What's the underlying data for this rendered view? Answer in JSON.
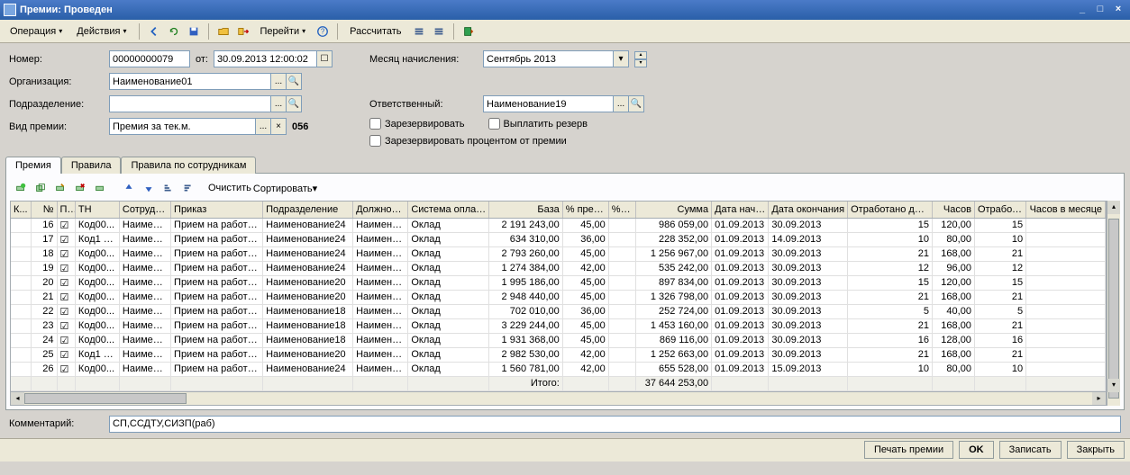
{
  "title": "Премии: Проведен",
  "toolbar": {
    "operation": "Операция",
    "actions": "Действия",
    "goto": "Перейти",
    "calculate": "Рассчитать"
  },
  "form": {
    "number_lbl": "Номер:",
    "number_val": "00000000079",
    "ot_lbl": "от:",
    "date_val": "30.09.2013 12:00:02",
    "org_lbl": "Организация:",
    "org_val": "Наименование01",
    "subdiv_lbl": "Подразделение:",
    "subdiv_val": "",
    "kind_lbl": "Вид премии:",
    "kind_val": "Премия за тек.м.",
    "kind_code": "056",
    "month_lbl": "Месяц начисления:",
    "month_val": "Сентябрь 2013",
    "resp_lbl": "Ответственный:",
    "resp_val": "Наименование19",
    "reserve_chk": "Зарезервировать",
    "payreserve_chk": "Выплатить резерв",
    "reservepct_chk": "Зарезервировать процентом от премии"
  },
  "tabs": [
    "Премия",
    "Правила",
    "Правила по сотрудникам"
  ],
  "innertoolbar": {
    "clear": "Очистить",
    "sort": "Сортировать"
  },
  "grid": {
    "headers": [
      "К...",
      "№ ",
      "П...",
      "ТН",
      "Сотрудник",
      "Приказ",
      "Подразделение",
      "Должность",
      "Система оплаты",
      "База",
      "% премии",
      "% л...",
      "Сумма",
      "Дата нача...",
      "Дата окончания",
      "Отработано дней",
      "Часов",
      "Отработа...",
      "Часов в месяце"
    ],
    "rows": [
      {
        "n": "16",
        "chk": true,
        "tn": "Код00...",
        "sotr": "Наимено...",
        "prik": "Прием на работу ...",
        "podr": "Наименование24",
        "dolzh": "Наимено...",
        "sys": "Оклад",
        "base": "2 191 243,00",
        "pct": "45,00",
        "pl": "",
        "sum": "986 059,00",
        "d1": "01.09.2013",
        "d2": "30.09.2013",
        "od": "15",
        "h1": "120,00",
        "ot": "15",
        "h2": ""
      },
      {
        "n": "17",
        "chk": true,
        "tn": "Код1 1...",
        "sotr": "Наимено...",
        "prik": "Прием на работу ...",
        "podr": "Наименование24",
        "dolzh": "Наимено...",
        "sys": "Оклад",
        "base": "634 310,00",
        "pct": "36,00",
        "pl": "",
        "sum": "228 352,00",
        "d1": "01.09.2013",
        "d2": "14.09.2013",
        "od": "10",
        "h1": "80,00",
        "ot": "10",
        "h2": ""
      },
      {
        "n": "18",
        "chk": true,
        "tn": "Код00...",
        "sotr": "Наимено...",
        "prik": "Прием на работу ...",
        "podr": "Наименование24",
        "dolzh": "Наимено...",
        "sys": "Оклад",
        "base": "2 793 260,00",
        "pct": "45,00",
        "pl": "",
        "sum": "1 256 967,00",
        "d1": "01.09.2013",
        "d2": "30.09.2013",
        "od": "21",
        "h1": "168,00",
        "ot": "21",
        "h2": ""
      },
      {
        "n": "19",
        "chk": true,
        "tn": "Код00...",
        "sotr": "Наимено...",
        "prik": "Прием на работу ...",
        "podr": "Наименование24",
        "dolzh": "Наимено...",
        "sys": "Оклад",
        "base": "1 274 384,00",
        "pct": "42,00",
        "pl": "",
        "sum": "535 242,00",
        "d1": "01.09.2013",
        "d2": "30.09.2013",
        "od": "12",
        "h1": "96,00",
        "ot": "12",
        "h2": ""
      },
      {
        "n": "20",
        "chk": true,
        "tn": "Код00...",
        "sotr": "Наимено...",
        "prik": "Прием на работу ...",
        "podr": "Наименование20",
        "dolzh": "Наимено...",
        "sys": "Оклад",
        "base": "1 995 186,00",
        "pct": "45,00",
        "pl": "",
        "sum": "897 834,00",
        "d1": "01.09.2013",
        "d2": "30.09.2013",
        "od": "15",
        "h1": "120,00",
        "ot": "15",
        "h2": ""
      },
      {
        "n": "21",
        "chk": true,
        "tn": "Код00...",
        "sotr": "Наимено...",
        "prik": "Прием на работу ...",
        "podr": "Наименование20",
        "dolzh": "Наимено...",
        "sys": "Оклад",
        "base": "2 948 440,00",
        "pct": "45,00",
        "pl": "",
        "sum": "1 326 798,00",
        "d1": "01.09.2013",
        "d2": "30.09.2013",
        "od": "21",
        "h1": "168,00",
        "ot": "21",
        "h2": ""
      },
      {
        "n": "22",
        "chk": true,
        "tn": "Код00...",
        "sotr": "Наимено...",
        "prik": "Прием на работу ...",
        "podr": "Наименование18",
        "dolzh": "Наимено...",
        "sys": "Оклад",
        "base": "702 010,00",
        "pct": "36,00",
        "pl": "",
        "sum": "252 724,00",
        "d1": "01.09.2013",
        "d2": "30.09.2013",
        "od": "5",
        "h1": "40,00",
        "ot": "5",
        "h2": ""
      },
      {
        "n": "23",
        "chk": true,
        "tn": "Код00...",
        "sotr": "Наимено...",
        "prik": "Прием на работу ...",
        "podr": "Наименование18",
        "dolzh": "Наимено...",
        "sys": "Оклад",
        "base": "3 229 244,00",
        "pct": "45,00",
        "pl": "",
        "sum": "1 453 160,00",
        "d1": "01.09.2013",
        "d2": "30.09.2013",
        "od": "21",
        "h1": "168,00",
        "ot": "21",
        "h2": ""
      },
      {
        "n": "24",
        "chk": true,
        "tn": "Код00...",
        "sotr": "Наимено...",
        "prik": "Прием на работу ...",
        "podr": "Наименование18",
        "dolzh": "Наимено...",
        "sys": "Оклад",
        "base": "1 931 368,00",
        "pct": "45,00",
        "pl": "",
        "sum": "869 116,00",
        "d1": "01.09.2013",
        "d2": "30.09.2013",
        "od": "16",
        "h1": "128,00",
        "ot": "16",
        "h2": ""
      },
      {
        "n": "25",
        "chk": true,
        "tn": "Код1 0...",
        "sotr": "Наимено...",
        "prik": "Прием на работу ...",
        "podr": "Наименование20",
        "dolzh": "Наимено...",
        "sys": "Оклад",
        "base": "2 982 530,00",
        "pct": "42,00",
        "pl": "",
        "sum": "1 252 663,00",
        "d1": "01.09.2013",
        "d2": "30.09.2013",
        "od": "21",
        "h1": "168,00",
        "ot": "21",
        "h2": ""
      },
      {
        "n": "26",
        "chk": true,
        "tn": "Код00...",
        "sotr": "Наимено...",
        "prik": "Прием на работу ...",
        "podr": "Наименование24",
        "dolzh": "Наимено...",
        "sys": "Оклад",
        "base": "1 560 781,00",
        "pct": "42,00",
        "pl": "",
        "sum": "655 528,00",
        "d1": "01.09.2013",
        "d2": "15.09.2013",
        "od": "10",
        "h1": "80,00",
        "ot": "10",
        "h2": ""
      }
    ],
    "footer": {
      "label": "Итого:",
      "sum": "37 644 253,00"
    }
  },
  "comment_lbl": "Комментарий:",
  "comment_val": "СП,ССДТУ,СИЗП(раб)",
  "footer_btns": {
    "print": "Печать премии",
    "ok": "OK",
    "save": "Записать",
    "close": "Закрыть"
  }
}
